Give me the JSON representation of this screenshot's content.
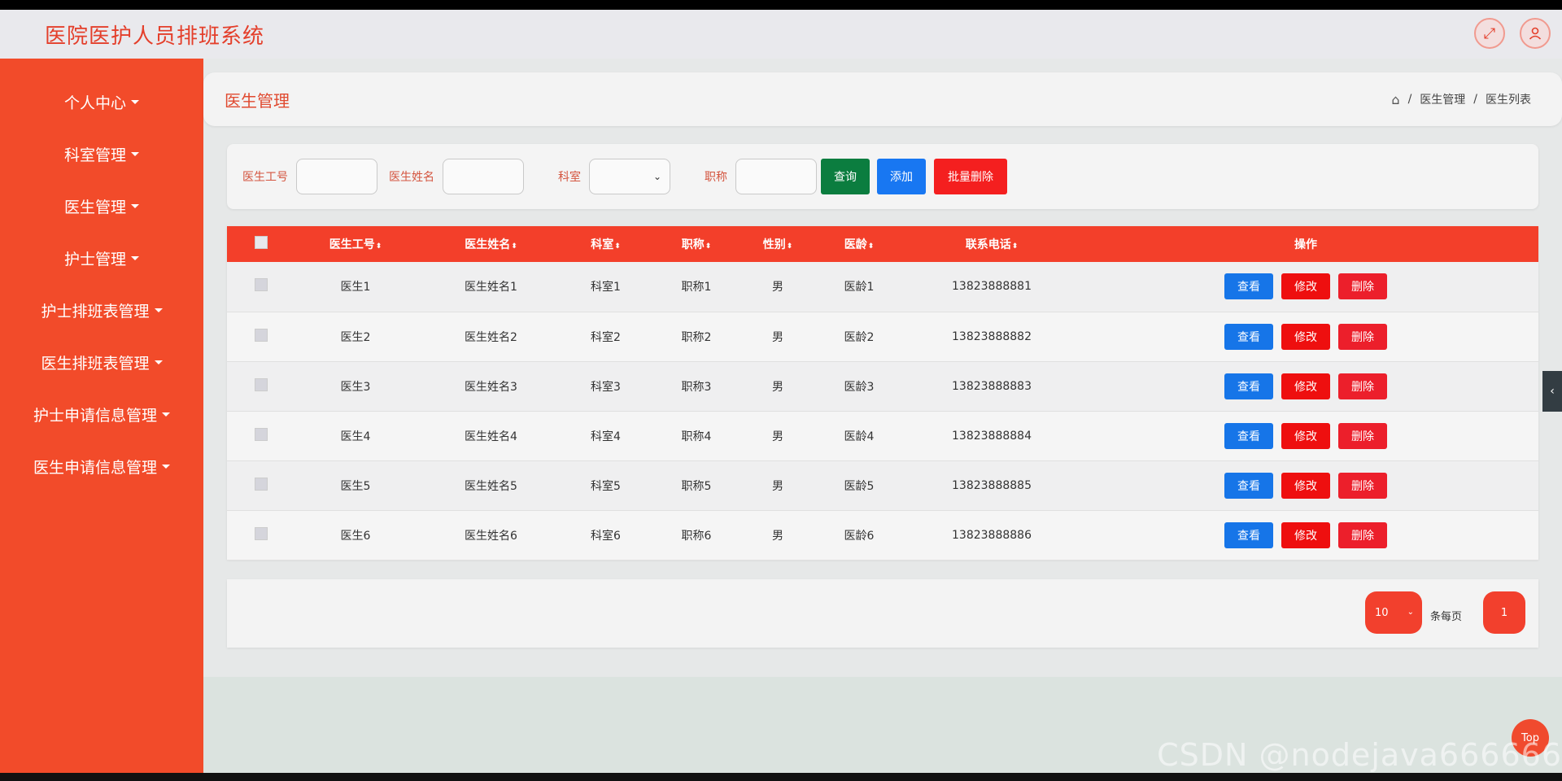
{
  "app": {
    "title": "医院医护人员排班系统"
  },
  "topbar": {
    "fullscreen_icon": "expand-icon",
    "user_icon": "user-icon"
  },
  "sidebar": {
    "items": [
      {
        "label": "个人中心"
      },
      {
        "label": "科室管理"
      },
      {
        "label": "医生管理"
      },
      {
        "label": "护士管理"
      },
      {
        "label": "护士排班表管理"
      },
      {
        "label": "医生排班表管理"
      },
      {
        "label": "护士申请信息管理"
      },
      {
        "label": "医生申请信息管理"
      }
    ]
  },
  "header": {
    "page_title": "医生管理",
    "breadcrumb": [
      "医生管理",
      "医生列表"
    ],
    "separator": "/"
  },
  "filter": {
    "doctor_id_label": "医生工号",
    "doctor_name_label": "医生姓名",
    "department_label": "科室",
    "title_label": "职称",
    "query_label": "查询",
    "add_label": "添加",
    "batch_delete_label": "批量删除",
    "dropdown_arrow": "⌄"
  },
  "table": {
    "sort_mark": "⬍",
    "columns": [
      "医生工号",
      "医生姓名",
      "科室",
      "职称",
      "性别",
      "医龄",
      "联系电话",
      "操作"
    ],
    "rows": [
      {
        "id": "医生1",
        "name": "医生姓名1",
        "dept": "科室1",
        "title": "职称1",
        "gender": "男",
        "age": "医龄1",
        "phone": "13823888881"
      },
      {
        "id": "医生2",
        "name": "医生姓名2",
        "dept": "科室2",
        "title": "职称2",
        "gender": "男",
        "age": "医龄2",
        "phone": "13823888882"
      },
      {
        "id": "医生3",
        "name": "医生姓名3",
        "dept": "科室3",
        "title": "职称3",
        "gender": "男",
        "age": "医龄3",
        "phone": "13823888883"
      },
      {
        "id": "医生4",
        "name": "医生姓名4",
        "dept": "科室4",
        "title": "职称4",
        "gender": "男",
        "age": "医龄4",
        "phone": "13823888884"
      },
      {
        "id": "医生5",
        "name": "医生姓名5",
        "dept": "科室5",
        "title": "职称5",
        "gender": "男",
        "age": "医龄5",
        "phone": "13823888885"
      },
      {
        "id": "医生6",
        "name": "医生姓名6",
        "dept": "科室6",
        "title": "职称6",
        "gender": "男",
        "age": "医龄6",
        "phone": "13823888886"
      }
    ],
    "actions": {
      "view": "查看",
      "edit": "修改",
      "delete": "删除"
    }
  },
  "pager": {
    "page_size": "10",
    "per_page_text": "条每页",
    "current_page": "1",
    "dropdown_arrow": "⌄"
  },
  "misc": {
    "top_label": "Top",
    "watermark": "CSDN @nodejava666666",
    "collapse_arrow": "‹"
  }
}
